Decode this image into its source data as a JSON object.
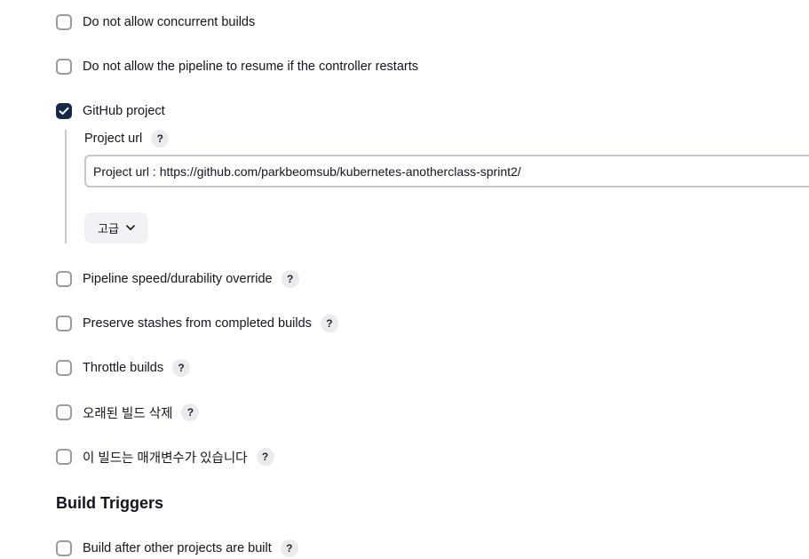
{
  "options": [
    {
      "label": "Do not allow concurrent builds",
      "checked": false,
      "help": false
    },
    {
      "label": "Do not allow the pipeline to resume if the controller restarts",
      "checked": false,
      "help": false
    },
    {
      "label": "GitHub project",
      "checked": true,
      "help": false
    },
    {
      "label": "Pipeline speed/durability override",
      "checked": false,
      "help": true
    },
    {
      "label": "Preserve stashes from completed builds",
      "checked": false,
      "help": true
    },
    {
      "label": "Throttle builds",
      "checked": false,
      "help": true
    },
    {
      "label": "오래된 빌드 삭제",
      "checked": false,
      "help": true
    },
    {
      "label": "이 빌드는 매개변수가 있습니다",
      "checked": false,
      "help": true
    }
  ],
  "github_project": {
    "field_label": "Project url",
    "field_value": "Project url : https://github.com/parkbeomsub/kubernetes-anotherclass-sprint2/",
    "advanced_label": "고급"
  },
  "help_glyph": "?",
  "build_triggers": {
    "title": "Build Triggers",
    "items": [
      {
        "label": "Build after other projects are built",
        "checked": false,
        "help": true
      }
    ]
  }
}
